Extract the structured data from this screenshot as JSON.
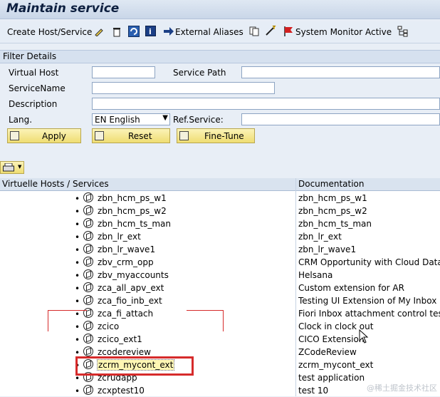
{
  "title": "Maintain service",
  "toolbar": {
    "create_label": "Create Host/Service",
    "external_aliases_label": "External Aliases",
    "system_monitor_label": "System Monitor Active"
  },
  "filter": {
    "section_title": "Filter Details",
    "virtual_host_label": "Virtual Host",
    "service_path_label": "Service Path",
    "servicename_label": "ServiceName",
    "description_label": "Description",
    "lang_label": "Lang.",
    "lang_value": "EN English",
    "ref_service_label": "Ref.Service:",
    "apply_label": "Apply",
    "reset_label": "Reset",
    "finetune_label": "Fine-Tune"
  },
  "grid": {
    "col_hosts": "Virtuelle Hosts / Services",
    "col_doc": "Documentation",
    "rows": [
      {
        "name": "zbn_hcm_ps_w1",
        "doc": "zbn_hcm_ps_w1"
      },
      {
        "name": "zbn_hcm_ps_w2",
        "doc": "zbn_hcm_ps_w2"
      },
      {
        "name": "zbn_hcm_ts_man",
        "doc": "zbn_hcm_ts_man"
      },
      {
        "name": "zbn_lr_ext",
        "doc": "zbn_lr_ext"
      },
      {
        "name": "zbn_lr_wave1",
        "doc": "zbn_lr_wave1"
      },
      {
        "name": "zbv_crm_opp",
        "doc": "CRM Opportunity with Cloud Data"
      },
      {
        "name": "zbv_myaccounts",
        "doc": "Helsana"
      },
      {
        "name": "zca_all_apv_ext",
        "doc": "Custom extension for AR"
      },
      {
        "name": "zca_fio_inb_ext",
        "doc": "Testing UI Extension of My Inbox"
      },
      {
        "name": "zca_fi_attach",
        "doc": "Fiori Inbox attachment control test"
      },
      {
        "name": "zcico",
        "doc": "Clock in clock out"
      },
      {
        "name": "zcico_ext1",
        "doc": "CICO Extension"
      },
      {
        "name": "zcodereview",
        "doc": "ZCodeReview"
      },
      {
        "name": "zcrm_mycont_ext",
        "doc": "zcrm_mycont_ext"
      },
      {
        "name": "zcrudapp",
        "doc": "test application"
      },
      {
        "name": "zcxptest10",
        "doc": "test 10"
      }
    ]
  },
  "watermark": "@稀土掘金技术社区",
  "colors": {
    "highlight": "#d62b2b",
    "button": "#efdd72"
  }
}
